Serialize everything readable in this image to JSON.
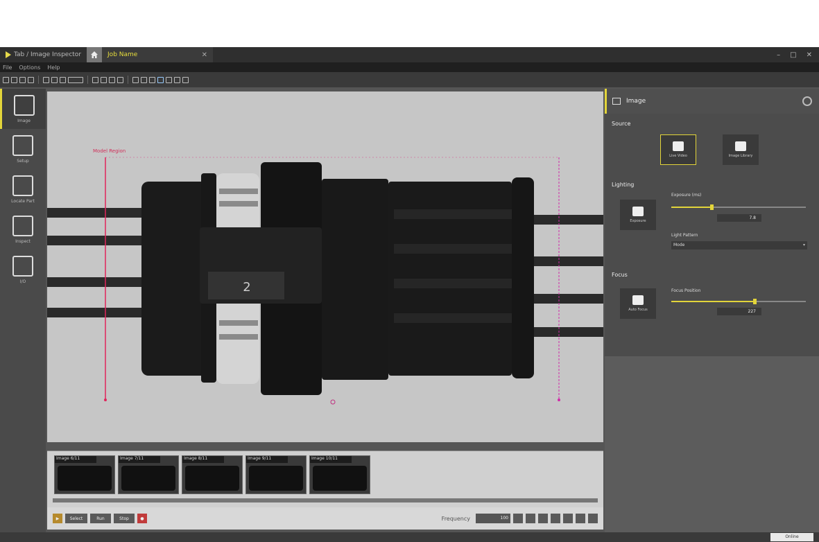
{
  "window": {
    "app_tab_label": "Tab / Image Inspector",
    "active_tab_label": "Job Name",
    "controls": [
      "–",
      "□",
      "✕"
    ]
  },
  "menu": [
    "File",
    "Options",
    "Help"
  ],
  "nav": [
    {
      "label": "Image",
      "icon": "monitor-icon"
    },
    {
      "label": "Setup",
      "icon": "tools-icon"
    },
    {
      "label": "Locate Part",
      "icon": "locate-icon"
    },
    {
      "label": "Inspect",
      "icon": "inspect-icon"
    },
    {
      "label": "I/O",
      "icon": "io-icon"
    }
  ],
  "viewer": {
    "roi_label": "Model Region",
    "connector_mark": "2"
  },
  "filmstrip": {
    "thumbs": [
      "Image 6/11",
      "Image 7/11",
      "Image 8/11",
      "Image 9/11",
      "Image 10/11"
    ]
  },
  "bottombar": {
    "buttons": [
      "Select",
      "Run",
      "Stop"
    ],
    "play_label": "",
    "label": "Frequency",
    "value": "100"
  },
  "panel": {
    "title": "Image",
    "source_label": "Source",
    "source_buttons": [
      "Live Video",
      "Image Library"
    ],
    "lighting_label": "Lighting",
    "auto_exposure_label": "Exposure",
    "exposure_label": "Exposure (ms)",
    "exposure_value": "7.8",
    "exposure_fraction": 0.3,
    "light_label": "Light Pattern",
    "light_value": "Mode",
    "focus_label": "Focus",
    "autofocus_label": "Auto Focus",
    "focus_pos_label": "Focus Position",
    "focus_value": "227",
    "focus_fraction": 0.62
  },
  "status": {
    "badge": "Online"
  }
}
